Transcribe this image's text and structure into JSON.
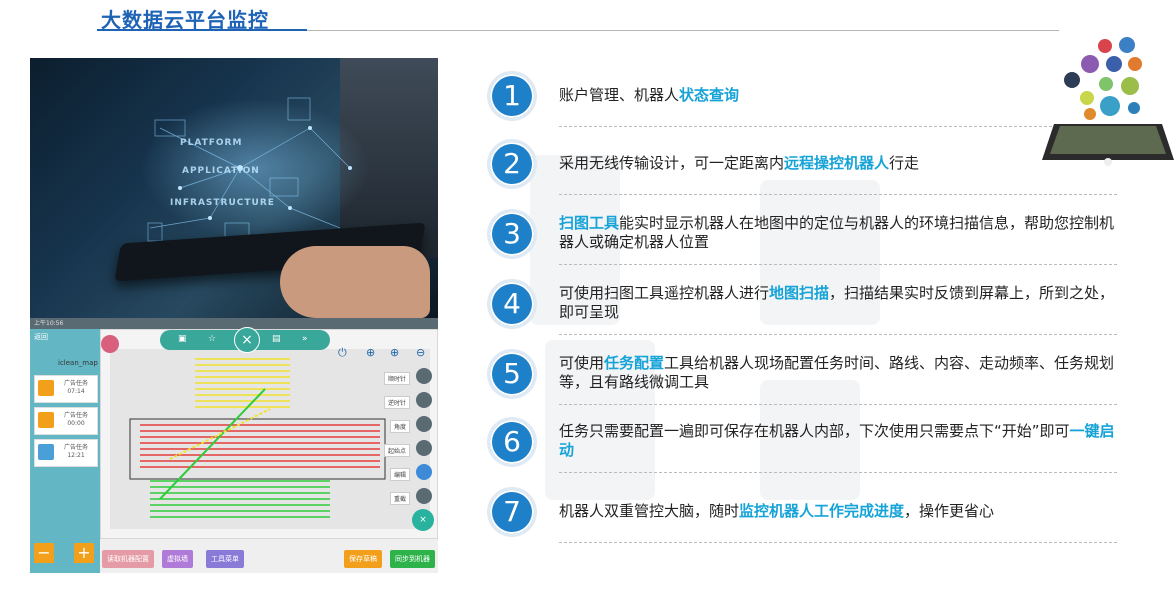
{
  "page": {
    "title": "大数据云平台监控"
  },
  "photo": {
    "holo_words": [
      "PLATFORM",
      "APPLICATION",
      "INFRASTRUCTURE"
    ]
  },
  "app": {
    "statusbar": "上午10:56",
    "back_label": "返回",
    "map_name": "iclean_map",
    "tasks": [
      {
        "label": "广告任务",
        "time": "07:14",
        "color": "#f2a01c"
      },
      {
        "label": "广告任务",
        "time": "00:00",
        "color": "#f2a01c"
      },
      {
        "label": "广告任务",
        "time": "12:21",
        "color": "#4a9fd8"
      }
    ],
    "right_tools": [
      "顺时针",
      "逆时针",
      "角度",
      "起始点",
      "编辑",
      "重截"
    ],
    "bottom_buttons": [
      {
        "label": "读取机器配置",
        "color": "#e59ba5"
      },
      {
        "label": "虚拟墙",
        "color": "#b07ad8"
      },
      {
        "label": "工具菜单",
        "color": "#8a7ad8"
      },
      {
        "label": "保存草稿",
        "color": "#f2a01c"
      },
      {
        "label": "同步到机器",
        "color": "#2db34a"
      }
    ],
    "minus_label": "−",
    "plus_label": "+",
    "close_label": "×"
  },
  "items": [
    {
      "num": "1",
      "parts": [
        {
          "t": "账户管理、机器人",
          "hl": false
        },
        {
          "t": "状态查询",
          "hl": true
        }
      ]
    },
    {
      "num": "2",
      "parts": [
        {
          "t": "采用无线传输设计，可一定距离内",
          "hl": false
        },
        {
          "t": "远程操控机器人",
          "hl": true
        },
        {
          "t": "行走",
          "hl": false
        }
      ]
    },
    {
      "num": "3",
      "parts": [
        {
          "t": "扫图工具",
          "hl": true
        },
        {
          "t": "能实时显示机器人在地图中的定位与机器人的环境扫描信息，帮助您控制机器人或确定机器人位置",
          "hl": false
        }
      ]
    },
    {
      "num": "4",
      "parts": [
        {
          "t": "可使用扫图工具遥控机器人进行",
          "hl": false
        },
        {
          "t": "地图扫描",
          "hl": true
        },
        {
          "t": "，扫描结果实时反馈到屏幕上，所到之处，即可呈现",
          "hl": false
        }
      ]
    },
    {
      "num": "5",
      "parts": [
        {
          "t": "可使用",
          "hl": false
        },
        {
          "t": "任务配置",
          "hl": true
        },
        {
          "t": "工具给机器人现场配置任务时间、路线、内容、走动频率、任务规划等，且有路线微调工具",
          "hl": false
        }
      ]
    },
    {
      "num": "6",
      "parts": [
        {
          "t": "任务只需要配置一遍即可保存在机器人内部，下次使用只需要点下“开始”即可",
          "hl": false
        },
        {
          "t": "一键启动",
          "hl": true
        }
      ]
    },
    {
      "num": "7",
      "parts": [
        {
          "t": "机器人双重管控大脑，随时",
          "hl": false
        },
        {
          "t": "监控机器人工作完成进度",
          "hl": true
        },
        {
          "t": "，操作更省心",
          "hl": false
        }
      ]
    }
  ],
  "colors": {
    "title": "#1f63b6",
    "highlight": "#16a3d8",
    "badge": "#1e80c8"
  }
}
